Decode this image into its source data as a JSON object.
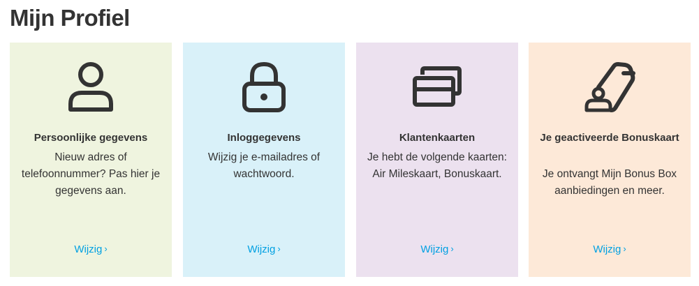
{
  "page": {
    "title": "Mijn Profiel"
  },
  "colors": {
    "link": "#00a0e2",
    "text": "#333333"
  },
  "cards": [
    {
      "icon": "person-icon",
      "background": "#eff4df",
      "title": "Persoonlijke gegevens",
      "description": "Nieuw adres of telefoonnummer? Pas hier je gegevens aan.",
      "link_label": "Wijzig",
      "link_chevron": "›"
    },
    {
      "icon": "lock-icon",
      "background": "#d9f1f9",
      "title": "Inloggegevens",
      "description": "Wijzig je e-mailadres of wachtwoord.",
      "link_label": "Wijzig",
      "link_chevron": "›"
    },
    {
      "icon": "cards-icon",
      "background": "#ece1ef",
      "title": "Klantenkaarten",
      "description": "Je hebt de volgende kaarten: Air Mileskaart, Bonuskaart.",
      "link_label": "Wijzig",
      "link_chevron": "›"
    },
    {
      "icon": "tag-person-icon",
      "background": "#fde9d8",
      "title": "Je geactiveerde Bonuskaart",
      "description": "Je ontvangt Mijn Bonus Box aanbiedingen en meer.",
      "link_label": "Wijzig",
      "link_chevron": "›"
    }
  ]
}
